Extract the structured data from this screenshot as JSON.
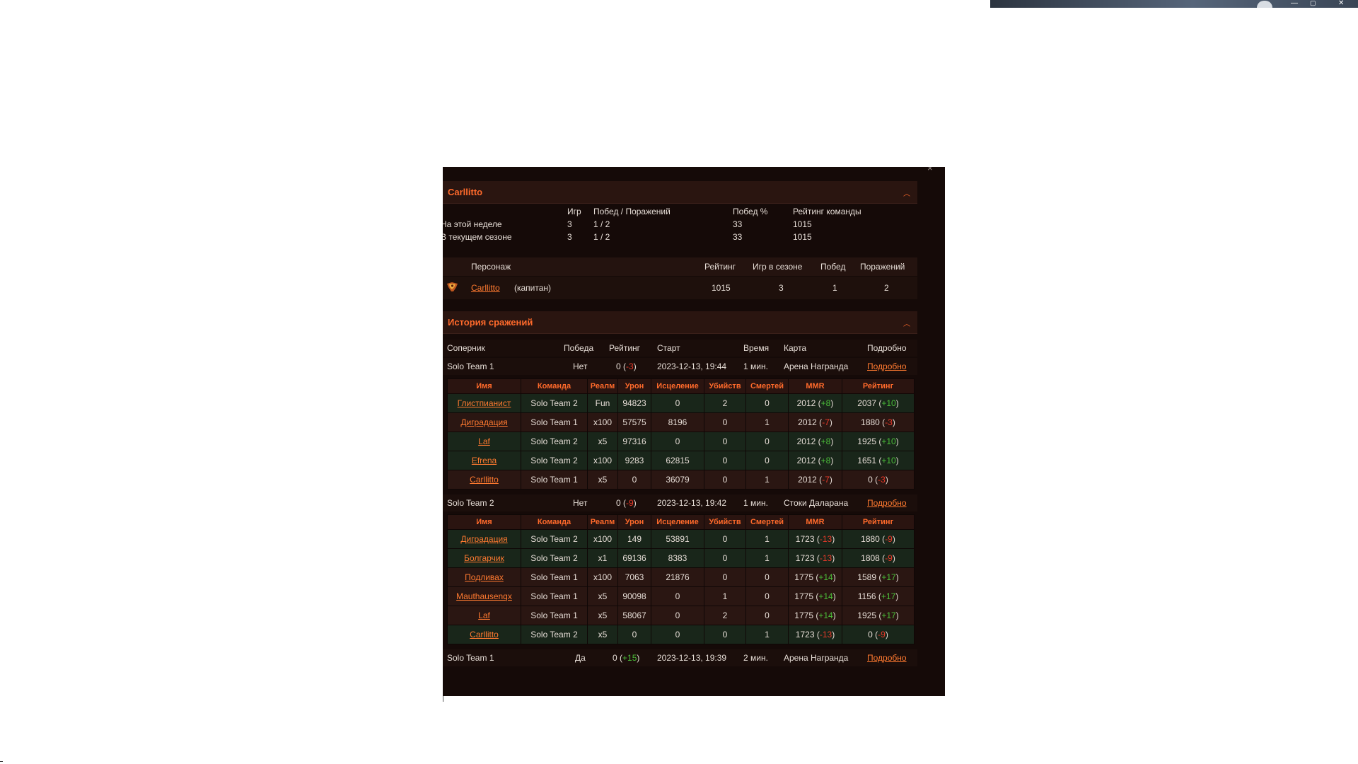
{
  "profile": {
    "name": "Carllitto",
    "summary_headers": [
      "Игр",
      "Побед / Поражений",
      "Побед %",
      "Рейтинг команды"
    ],
    "summary_rows": [
      {
        "label": "На этой неделе",
        "games": "3",
        "wl": "1 / 2",
        "pct": "33",
        "rating": "1015"
      },
      {
        "label": "В текущем сезоне",
        "games": "3",
        "wl": "1 / 2",
        "pct": "33",
        "rating": "1015"
      }
    ],
    "char_headers": [
      "Персонаж",
      "Рейтинг",
      "Игр в сезоне",
      "Побед",
      "Поражений"
    ],
    "char_row": {
      "name": "Carllitto",
      "role": "(капитан)",
      "rating": "1015",
      "games": "3",
      "wins": "1",
      "losses": "2"
    }
  },
  "history": {
    "title": "История сражений",
    "headers": [
      "Соперник",
      "Победа",
      "Рейтинг",
      "Старт",
      "Время",
      "Карта",
      "Подробно"
    ],
    "detail_headers": [
      "Имя",
      "Команда",
      "Реалм",
      "Урон",
      "Исцеление",
      "Убийств",
      "Смертей",
      "MMR",
      "Рейтинг"
    ],
    "matches": [
      {
        "opponent": "Solo Team 1",
        "win": "Нет",
        "rating": "0",
        "delta": "-3",
        "start": "2023-12-13, 19:44",
        "time": "1 мин.",
        "map": "Арена Награнда",
        "details": "Подробно",
        "players": [
          {
            "name": "Глистпианист",
            "team": "Solo Team 2",
            "realm": "Fun",
            "damage": "94823",
            "heal": "0",
            "kills": "2",
            "deaths": "0",
            "mmr": "2012",
            "mmr_delta": "+8",
            "rating": "2037",
            "rating_delta": "+10"
          },
          {
            "name": "Диградация",
            "team": "Solo Team 1",
            "realm": "x100",
            "damage": "57575",
            "heal": "8196",
            "kills": "0",
            "deaths": "1",
            "mmr": "2012",
            "mmr_delta": "-7",
            "rating": "1880",
            "rating_delta": "-3"
          },
          {
            "name": "Laf",
            "team": "Solo Team 2",
            "realm": "x5",
            "damage": "97316",
            "heal": "0",
            "kills": "0",
            "deaths": "0",
            "mmr": "2012",
            "mmr_delta": "+8",
            "rating": "1925",
            "rating_delta": "+10"
          },
          {
            "name": "Efrena",
            "team": "Solo Team 2",
            "realm": "x100",
            "damage": "9283",
            "heal": "62815",
            "kills": "0",
            "deaths": "0",
            "mmr": "2012",
            "mmr_delta": "+8",
            "rating": "1651",
            "rating_delta": "+10"
          },
          {
            "name": "Carllitto",
            "team": "Solo Team 1",
            "realm": "x5",
            "damage": "0",
            "heal": "36079",
            "kills": "0",
            "deaths": "1",
            "mmr": "2012",
            "mmr_delta": "-7",
            "rating": "0",
            "rating_delta": "-3"
          }
        ]
      },
      {
        "opponent": "Solo Team 2",
        "win": "Нет",
        "rating": "0",
        "delta": "-9",
        "start": "2023-12-13, 19:42",
        "time": "1 мин.",
        "map": "Стоки Даларана",
        "details": "Подробно",
        "players": [
          {
            "name": "Диградация",
            "team": "Solo Team 2",
            "realm": "x100",
            "damage": "149",
            "heal": "53891",
            "kills": "0",
            "deaths": "1",
            "mmr": "1723",
            "mmr_delta": "-13",
            "rating": "1880",
            "rating_delta": "-9"
          },
          {
            "name": "Болгарчик",
            "team": "Solo Team 2",
            "realm": "x1",
            "damage": "69136",
            "heal": "8383",
            "kills": "0",
            "deaths": "1",
            "mmr": "1723",
            "mmr_delta": "-13",
            "rating": "1808",
            "rating_delta": "-9"
          },
          {
            "name": "Подливах",
            "team": "Solo Team 1",
            "realm": "x100",
            "damage": "7063",
            "heal": "21876",
            "kills": "0",
            "deaths": "0",
            "mmr": "1775",
            "mmr_delta": "+14",
            "rating": "1589",
            "rating_delta": "+17"
          },
          {
            "name": "Mauthausenqx",
            "team": "Solo Team 1",
            "realm": "x5",
            "damage": "90098",
            "heal": "0",
            "kills": "1",
            "deaths": "0",
            "mmr": "1775",
            "mmr_delta": "+14",
            "rating": "1156",
            "rating_delta": "+17"
          },
          {
            "name": "Laf",
            "team": "Solo Team 1",
            "realm": "x5",
            "damage": "58067",
            "heal": "0",
            "kills": "2",
            "deaths": "0",
            "mmr": "1775",
            "mmr_delta": "+14",
            "rating": "1925",
            "rating_delta": "+17"
          },
          {
            "name": "Carllitto",
            "team": "Solo Team 2",
            "realm": "x5",
            "damage": "0",
            "heal": "0",
            "kills": "0",
            "deaths": "1",
            "mmr": "1723",
            "mmr_delta": "-13",
            "rating": "0",
            "rating_delta": "-9"
          }
        ]
      },
      {
        "opponent": "Solo Team 1",
        "win": "Да",
        "rating": "0",
        "delta": "+15",
        "start": "2023-12-13, 19:39",
        "time": "2 мин.",
        "map": "Арена Награнда",
        "details": "Подробно",
        "players": []
      }
    ]
  },
  "window": {
    "close_glyph": "×"
  },
  "colors": {
    "accent": "#ff6a2b",
    "positive": "#4cbf3a",
    "negative": "#e83a2a",
    "panel_bg": "#150a08"
  }
}
